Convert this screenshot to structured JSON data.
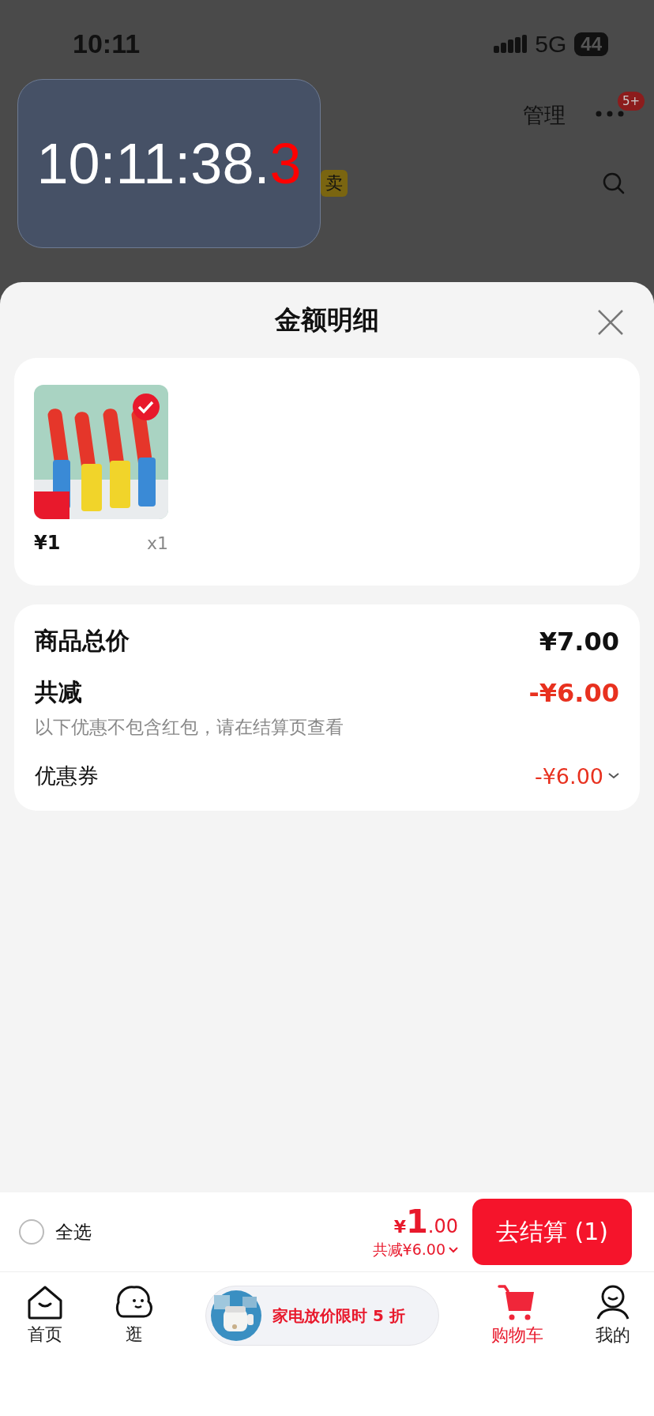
{
  "status_bar": {
    "time": "10:11",
    "network": "5G",
    "battery": "44"
  },
  "clock_overlay": {
    "main": "10:11:38.",
    "tenths": "3"
  },
  "background_header": {
    "manage": "管理",
    "badge": "5+",
    "tag": "卖"
  },
  "sheet": {
    "title": "金额明细"
  },
  "product": {
    "kind": "picture",
    "price": "¥1",
    "quantity": "x1"
  },
  "summary": [
    {
      "kind": "total",
      "label": "商品总价",
      "value": "¥7.00"
    },
    {
      "kind": "discount",
      "label": "共减",
      "value": "-¥6.00",
      "note": "以下优惠不包含红包，请在结算页查看"
    },
    {
      "kind": "coupon",
      "label": "优惠券",
      "value": "-¥6.00"
    }
  ],
  "checkout_bar": {
    "select_all": {
      "label": "全选",
      "checked": false
    },
    "price_symbol": "¥",
    "price_int": "1",
    "price_dec": ".00",
    "saved": "共减¥6.00",
    "button": "去结算 (1)"
  },
  "tab_bar": [
    {
      "kind": "tab",
      "label": "首页",
      "selected": false
    },
    {
      "kind": "tab",
      "label": "逛",
      "selected": false
    },
    {
      "kind": "promo",
      "label": "家电放价限时 5 折"
    },
    {
      "kind": "tab",
      "label": "购物车",
      "selected": true
    },
    {
      "kind": "tab",
      "label": "我的",
      "selected": false
    }
  ]
}
